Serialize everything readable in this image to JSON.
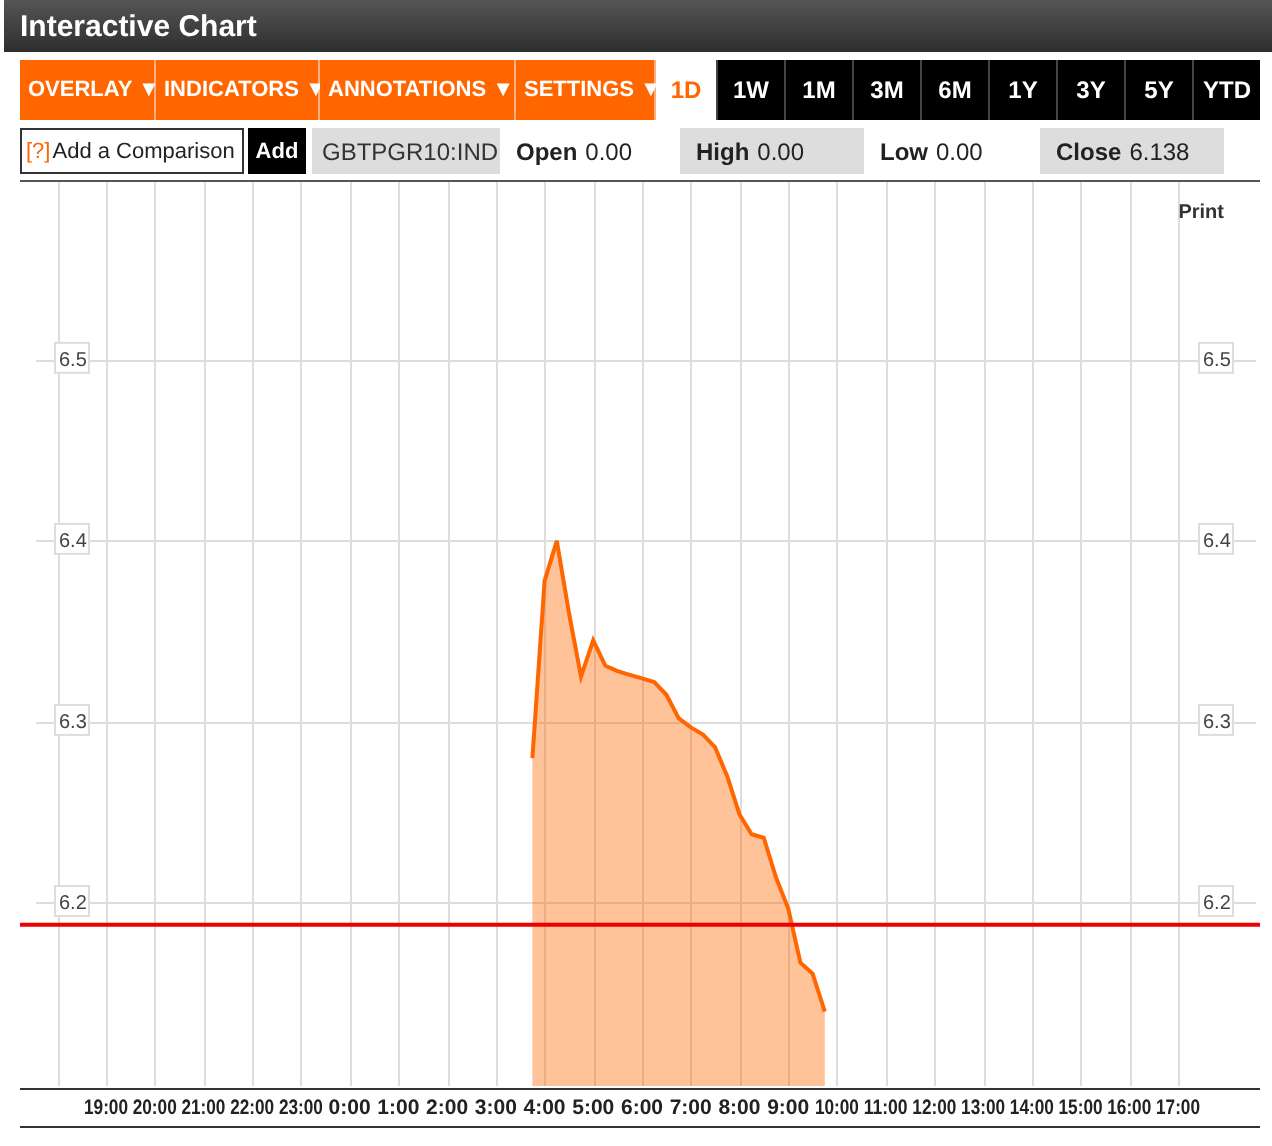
{
  "window": {
    "title": "Interactive Chart"
  },
  "menus": [
    {
      "label": "OVERLAY ▼"
    },
    {
      "label": "INDICATORS ▼"
    },
    {
      "label": "ANNOTATIONS ▼"
    },
    {
      "label": "SETTINGS ▼"
    }
  ],
  "ranges": [
    {
      "label": "1D",
      "selected": true
    },
    {
      "label": "1W",
      "selected": false
    },
    {
      "label": "1M",
      "selected": false
    },
    {
      "label": "3M",
      "selected": false
    },
    {
      "label": "6M",
      "selected": false
    },
    {
      "label": "1Y",
      "selected": false
    },
    {
      "label": "3Y",
      "selected": false
    },
    {
      "label": "5Y",
      "selected": false
    },
    {
      "label": "YTD",
      "selected": false
    }
  ],
  "comparison": {
    "help": "[?]",
    "placeholder": "Add a Comparison",
    "button": "Add"
  },
  "ticker": "GBTPGR10:IND",
  "quotes": [
    {
      "label": "Open",
      "value": "0.00"
    },
    {
      "label": "High",
      "value": "0.00"
    },
    {
      "label": "Low",
      "value": "0.00"
    },
    {
      "label": "Close",
      "value": "6.138"
    }
  ],
  "print": "Print",
  "right_axis_labels": [
    "6.5",
    "6.4",
    "6.3",
    "6.2"
  ],
  "chart_data": {
    "type": "area",
    "ylim": [
      6.1,
      6.6
    ],
    "yticks": [
      6.2,
      6.3,
      6.4,
      6.5
    ],
    "categories": [
      "19:00",
      null,
      null,
      null,
      "20:00",
      null,
      null,
      null,
      "21:00",
      null,
      null,
      null,
      "22:00",
      null,
      null,
      null,
      "23:00",
      null,
      null,
      null,
      "0:00",
      null,
      null,
      null,
      "1:00",
      null,
      null,
      null,
      "2:00",
      null,
      null,
      null,
      "3:00",
      null,
      null,
      null,
      "4:00",
      null,
      null,
      null,
      "5:00",
      null,
      null,
      null,
      "6:00",
      null,
      null,
      null,
      "7:00",
      null,
      null,
      null,
      "8:00",
      null,
      null,
      null,
      "9:00",
      null,
      null,
      null,
      "10:00",
      null,
      null,
      null,
      "11:00",
      null,
      null,
      null,
      "12:00",
      null,
      null,
      null,
      "13:00",
      null,
      null,
      null,
      "14:00",
      null,
      null,
      null,
      "15:00",
      null,
      null,
      null,
      "16:00",
      null,
      null,
      null,
      "17:00"
    ],
    "series": [
      {
        "color": "#ff6600",
        "values": [
          null,
          null,
          null,
          null,
          null,
          null,
          null,
          null,
          null,
          null,
          null,
          null,
          null,
          null,
          null,
          null,
          null,
          null,
          null,
          null,
          null,
          null,
          null,
          null,
          null,
          null,
          null,
          null,
          null,
          null,
          null,
          null,
          null,
          null,
          null,
          6.28,
          6.378,
          6.4,
          6.36,
          6.325,
          6.345,
          6.331,
          6.328,
          6.326,
          6.324,
          6.322,
          6.315,
          6.302,
          6.297,
          6.293,
          6.286,
          6.27,
          6.249,
          6.238,
          6.236,
          6.214,
          6.197,
          6.167,
          6.161,
          6.14,
          null,
          null,
          null,
          null,
          null,
          null,
          null,
          null,
          null,
          null,
          null,
          null,
          null,
          null,
          null,
          null,
          null,
          null,
          null,
          null,
          null,
          null,
          null,
          null,
          null,
          null,
          null,
          null,
          null
        ]
      }
    ],
    "grid": true,
    "ref_lines": [
      {
        "axis": "y",
        "value": 6.188,
        "color": "#ee0000"
      }
    ]
  }
}
